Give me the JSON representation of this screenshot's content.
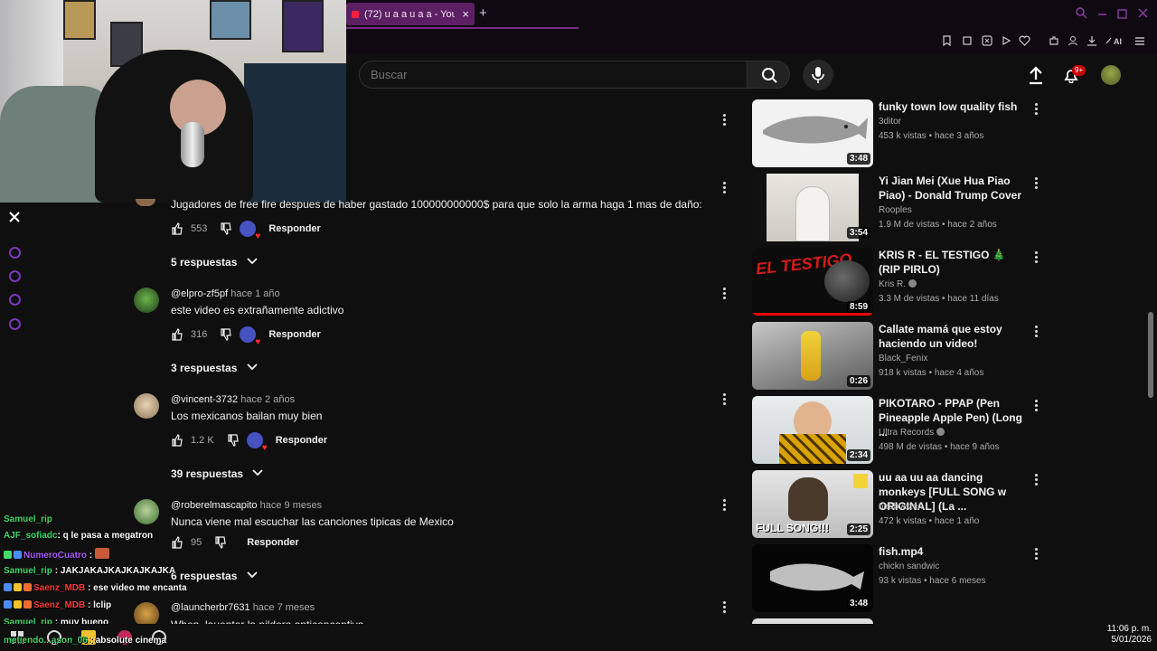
{
  "browser": {
    "tab_title": "(72) u a a u a a - You",
    "tab_close": "×",
    "tab_new": "+"
  },
  "search": {
    "placeholder": "Buscar"
  },
  "notifications": {
    "badge": "9+"
  },
  "comments": [
    {
      "text": "Jugadores de free fire despues de haber gastado 100000000000$ para que solo la arma haga 1 mas de daño:",
      "likes": "553",
      "reply_label": "Responder",
      "replies": "5 respuestas"
    },
    {
      "author": "@elpro-zf5pf",
      "time": "hace 1 año",
      "text": "este video es extrañamente adictivo",
      "likes": "316",
      "reply_label": "Responder",
      "replies": "3 respuestas"
    },
    {
      "author": "@vincent-3732",
      "time": "hace 2 años",
      "text": "Los mexicanos bailan muy bien",
      "likes": "1.2 K",
      "reply_label": "Responder",
      "replies": "39 respuestas"
    },
    {
      "author": "@roberelmascapito",
      "time": "hace 9 meses",
      "text": "Nunca viene mal escuchar las canciones tipicas de Mexico",
      "likes": "95",
      "reply_label": "Responder",
      "replies": "6 respuestas"
    },
    {
      "author": "@launcherbr7631",
      "time": "hace 7 meses",
      "text": "When, lauenter la pildora anticonceptiva"
    }
  ],
  "recommendations": [
    {
      "title": "funky town low quality fish",
      "channel": "3ditor",
      "meta": "453 k vistas • hace 3 años",
      "duration": "3:48"
    },
    {
      "title": "Yi Jian Mei (Xue Hua Piao Piao) - Donald Trump Cover",
      "channel": "Rooples",
      "meta": "1.9 M de vistas • hace 2 años",
      "duration": "3:54"
    },
    {
      "title": "KRIS R - EL TESTIGO 🎄 (RIP PIRLO)",
      "channel": "Kris R.",
      "meta": "3.3 M de vistas • hace 11 días",
      "duration": "8:59"
    },
    {
      "title": "Callate mamá que estoy haciendo un video!",
      "channel": "Black_Fenix",
      "meta": "918 k vistas • hace 4 años",
      "duration": "0:26"
    },
    {
      "title": "PIKOTARO - PPAP (Pen Pineapple Apple Pen) (Long ...",
      "channel": "Ultra Records",
      "meta": "498 M de vistas • hace 9 años",
      "duration": "2:34"
    },
    {
      "title": "uu aa uu aa dancing monkeys [FULL SONG w ORIGINAL] (La ...",
      "channel": "neobvezen",
      "meta": "472 k vistas • hace 1 año",
      "duration": "2:25",
      "thumb_text": "FULL SONG!!!"
    },
    {
      "title": "fish.mp4",
      "channel": "chickn sandwic",
      "meta": "93 k vistas • hace 6 meses",
      "duration": "3:48"
    }
  ],
  "chat": [
    {
      "user": "Samuel_rip",
      "msg": ""
    },
    {
      "user": "AJF_sofiadc",
      "msg": "q le pasa a megatron"
    },
    {
      "user": "NumeroCuatro",
      "msg": ""
    },
    {
      "user": "Samuel_rip",
      "msg": "JAKJAKAJKAJKAJKAJKA"
    },
    {
      "user": "Saenz_MDB",
      "msg": "ese video me encanta"
    },
    {
      "user": "Saenz_MDB",
      "msg": "lclip"
    },
    {
      "user": "Samuel_rip",
      "msg": "muy bueno"
    },
    {
      "user": "metiendo...ason_06",
      "msg": "absolute cinema"
    }
  ],
  "clock": {
    "time": "11:06 p. m.",
    "date": "5/01/2026"
  },
  "colors": {
    "tab_accent": "#5c1f63",
    "bg": "#0f0f0f",
    "chat_green": "#43d96b",
    "chat_purple": "#b05cff",
    "chat_red": "#ff3b3b"
  }
}
